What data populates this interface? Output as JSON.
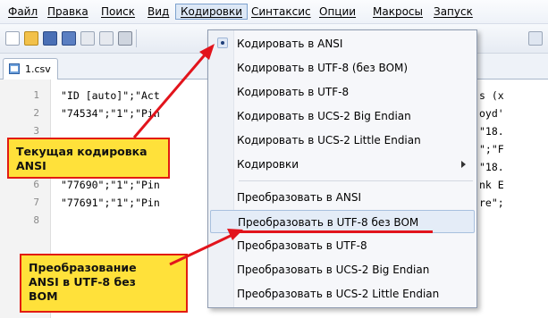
{
  "menubar": {
    "items": [
      "Файл",
      "Правка",
      "Поиск",
      "Вид",
      "Кодировки",
      "Синтаксис",
      "Опции",
      "Макросы",
      "Запуск"
    ],
    "active_index": 4
  },
  "toolbar": {
    "icons": [
      "new-file-icon",
      "open-file-icon",
      "save-icon",
      "save-all-icon",
      "close-icon",
      "close-all-icon",
      "print-icon"
    ]
  },
  "tab": {
    "label": "1.csv"
  },
  "editor": {
    "lines": [
      {
        "n": "1",
        "text": "\"ID [auto]\";\"Act",
        "right": "s (x"
      },
      {
        "n": "2",
        "text": "\"74534\";\"1\";\"Pin",
        "right": "oyd'"
      },
      {
        "n": "3",
        "text": "",
        "right": "\"18."
      },
      {
        "n": "4",
        "text": "",
        "right": "\";\"F"
      },
      {
        "n": "5",
        "text": "",
        "right": "\"18."
      },
      {
        "n": "6",
        "text": "\"77690\";\"1\";\"Pin",
        "right": "nk E"
      },
      {
        "n": "7",
        "text": "\"77691\";\"1\";\"Pin",
        "right": "re\";"
      },
      {
        "n": "8",
        "text": "",
        "right": ""
      }
    ]
  },
  "dropdown": {
    "group1": [
      "Кодировать в ANSI",
      "Кодировать в UTF-8 (без BOM)",
      "Кодировать в UTF-8",
      "Кодировать в UCS-2 Big Endian",
      "Кодировать в UCS-2 Little Endian",
      "Кодировки"
    ],
    "group2": [
      "Преобразовать в ANSI",
      "Преобразовать в UTF-8 без BOM",
      "Преобразовать в UTF-8",
      "Преобразовать в UCS-2 Big Endian",
      "Преобразовать в UCS-2 Little Endian"
    ]
  },
  "callouts": {
    "current": {
      "line1": "Текущая кодировка",
      "line2": "ANSI"
    },
    "convert": {
      "line1": "Преобразование",
      "line2": "ANSI в UTF-8 без",
      "line3": "BOM"
    }
  },
  "colors": {
    "callout_fill": "#ffe13a",
    "callout_border": "#e21b12",
    "arrow": "#e2141c",
    "highlight": "#e4ecf7"
  }
}
